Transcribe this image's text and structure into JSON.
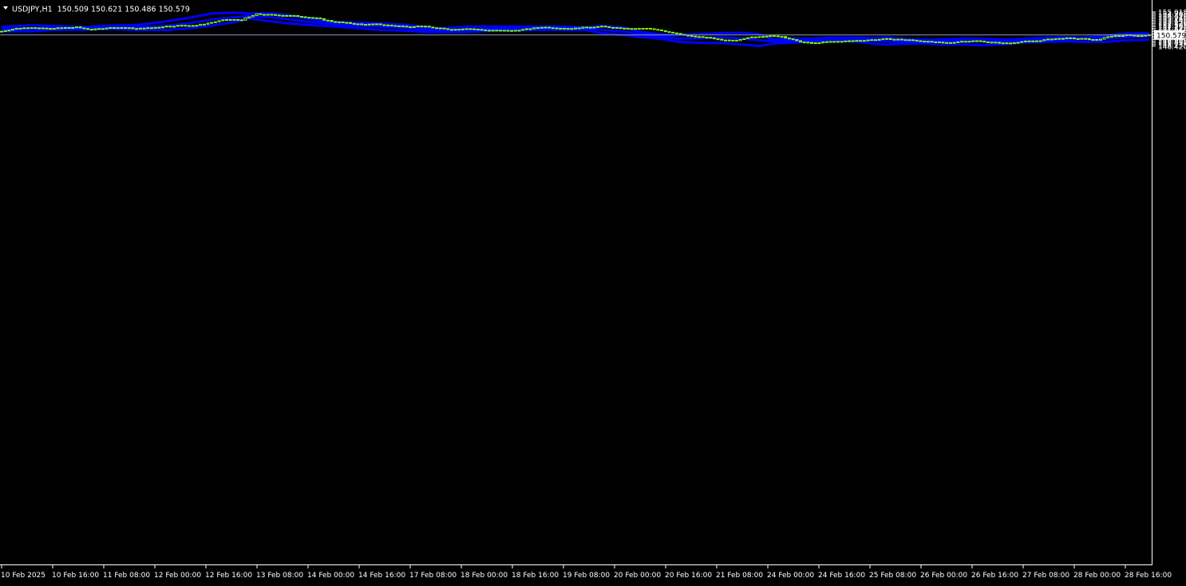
{
  "symbol": "USDJPY",
  "timeframe": "H1",
  "ohlc": {
    "open": "150.509",
    "high": "150.621",
    "low": "150.486",
    "close": "150.579"
  },
  "header_text": "USDJPY,H1  150.509 150.621 150.486 150.579",
  "current_price_label": "150.579",
  "colors": {
    "background": "#000000",
    "candle": "#7CFC00",
    "band": "#0000FF",
    "axis": "#FFFFFF",
    "price_line": "#8E9CC0"
  },
  "chart_data": {
    "type": "candlestick",
    "title": "",
    "ylim": [
      48.42,
      155.015
    ],
    "y_ticks": [
      155.015,
      154.705,
      154.39,
      154.075,
      153.76,
      153.445,
      153.13,
      152.82,
      152.505,
      152.19,
      151.875,
      151.56,
      151.25,
      150.935,
      150.62,
      150.305,
      149.99,
      149.68,
      149.365,
      149.05,
      148.735,
      148.42
    ],
    "y_tick_labels": [
      "155.015",
      "154.705",
      "154.390",
      "154.075",
      "153.760",
      "153.445",
      "153.130",
      "152.820",
      "152.505",
      "152.190",
      "151.875",
      "151.560",
      "151.250",
      "150.935",
      "150.620",
      "150.305",
      "149.990",
      "149.680",
      "149.365",
      "149.050",
      "148.735",
      "148.420"
    ],
    "x_labels": [
      "10 Feb 2025",
      "10 Feb 16:00",
      "11 Feb 08:00",
      "12 Feb 00:00",
      "12 Feb 16:00",
      "13 Feb 08:00",
      "14 Feb 00:00",
      "14 Feb 16:00",
      "17 Feb 08:00",
      "18 Feb 00:00",
      "18 Feb 16:00",
      "19 Feb 08:00",
      "20 Feb 00:00",
      "20 Feb 16:00",
      "21 Feb 08:00",
      "24 Feb 00:00",
      "24 Feb 16:00",
      "25 Feb 08:00",
      "26 Feb 00:00",
      "26 Feb 16:00",
      "27 Feb 08:00",
      "28 Feb 00:00",
      "28 Feb 16:00"
    ],
    "current_price": 150.579,
    "close_path": [
      [
        0,
        151.3
      ],
      [
        4,
        151.85
      ],
      [
        8,
        152.05
      ],
      [
        12,
        151.75
      ],
      [
        16,
        151.95
      ],
      [
        20,
        152.05
      ],
      [
        24,
        151.6
      ],
      [
        28,
        151.95
      ],
      [
        32,
        152.0
      ],
      [
        36,
        151.8
      ],
      [
        40,
        151.95
      ],
      [
        44,
        152.25
      ],
      [
        48,
        152.4
      ],
      [
        52,
        152.45
      ],
      [
        56,
        153.0
      ],
      [
        60,
        153.55
      ],
      [
        64,
        153.5
      ],
      [
        68,
        154.6
      ],
      [
        72,
        154.45
      ],
      [
        76,
        154.35
      ],
      [
        80,
        154.15
      ],
      [
        84,
        153.8
      ],
      [
        88,
        153.2
      ],
      [
        92,
        152.9
      ],
      [
        96,
        152.6
      ],
      [
        100,
        152.65
      ],
      [
        104,
        152.4
      ],
      [
        108,
        152.2
      ],
      [
        112,
        152.3
      ],
      [
        116,
        151.9
      ],
      [
        120,
        151.6
      ],
      [
        124,
        151.85
      ],
      [
        128,
        151.55
      ],
      [
        132,
        151.45
      ],
      [
        136,
        151.4
      ],
      [
        140,
        151.7
      ],
      [
        144,
        152.1
      ],
      [
        148,
        151.95
      ],
      [
        152,
        151.8
      ],
      [
        156,
        152.1
      ],
      [
        160,
        152.2
      ],
      [
        164,
        151.9
      ],
      [
        168,
        151.75
      ],
      [
        172,
        151.85
      ],
      [
        176,
        151.4
      ],
      [
        180,
        150.9
      ],
      [
        184,
        150.3
      ],
      [
        188,
        150.1
      ],
      [
        192,
        149.6
      ],
      [
        196,
        149.45
      ],
      [
        200,
        150.2
      ],
      [
        204,
        150.4
      ],
      [
        208,
        150.3
      ],
      [
        212,
        149.4
      ],
      [
        216,
        148.95
      ],
      [
        220,
        149.25
      ],
      [
        224,
        149.35
      ],
      [
        228,
        149.5
      ],
      [
        232,
        149.65
      ],
      [
        236,
        149.8
      ],
      [
        240,
        149.7
      ],
      [
        244,
        149.5
      ],
      [
        248,
        149.2
      ],
      [
        252,
        149.05
      ],
      [
        256,
        149.35
      ],
      [
        260,
        149.45
      ],
      [
        264,
        149.15
      ],
      [
        268,
        148.95
      ],
      [
        272,
        149.3
      ],
      [
        276,
        149.45
      ],
      [
        280,
        149.8
      ],
      [
        284,
        149.95
      ],
      [
        288,
        149.85
      ],
      [
        292,
        149.6
      ],
      [
        296,
        150.4
      ],
      [
        300,
        150.55
      ],
      [
        304,
        150.45
      ],
      [
        306,
        150.55
      ]
    ],
    "bands": [
      {
        "name": "",
        "values": [
          [
            0,
            152.15
          ],
          [
            8,
            152.45
          ],
          [
            14,
            152.3
          ],
          [
            22,
            152.1
          ],
          [
            28,
            152.35
          ],
          [
            36,
            152.5
          ],
          [
            44,
            153.2
          ],
          [
            50,
            153.9
          ],
          [
            56,
            154.7
          ],
          [
            62,
            154.9
          ],
          [
            66,
            154.7
          ],
          [
            72,
            154.75
          ],
          [
            76,
            154.45
          ],
          [
            82,
            153.7
          ],
          [
            88,
            153.1
          ],
          [
            94,
            152.95
          ],
          [
            100,
            152.85
          ],
          [
            108,
            152.5
          ],
          [
            114,
            151.95
          ],
          [
            118,
            151.85
          ],
          [
            124,
            152.2
          ],
          [
            132,
            152.2
          ],
          [
            140,
            152.2
          ],
          [
            148,
            152.2
          ],
          [
            156,
            152.05
          ],
          [
            160,
            152.3
          ],
          [
            166,
            152.0
          ],
          [
            170,
            151.2
          ],
          [
            176,
            150.65
          ],
          [
            180,
            150.55
          ],
          [
            186,
            150.75
          ],
          [
            192,
            150.95
          ],
          [
            198,
            151.0
          ],
          [
            202,
            150.7
          ],
          [
            206,
            149.7
          ],
          [
            210,
            149.85
          ],
          [
            216,
            149.9
          ],
          [
            222,
            150.05
          ],
          [
            228,
            150.05
          ],
          [
            232,
            150.0
          ],
          [
            236,
            150.1
          ],
          [
            240,
            149.85
          ],
          [
            246,
            149.65
          ],
          [
            250,
            149.7
          ],
          [
            256,
            149.85
          ],
          [
            262,
            149.85
          ],
          [
            268,
            149.65
          ],
          [
            272,
            149.8
          ],
          [
            278,
            150.05
          ],
          [
            284,
            150.1
          ],
          [
            288,
            150.0
          ],
          [
            294,
            150.45
          ],
          [
            300,
            150.85
          ],
          [
            306,
            150.9
          ]
        ]
      },
      {
        "name": "",
        "values": [
          [
            0,
            151.75
          ],
          [
            8,
            151.8
          ],
          [
            14,
            151.95
          ],
          [
            22,
            152.0
          ],
          [
            28,
            151.9
          ],
          [
            36,
            152.05
          ],
          [
            44,
            152.3
          ],
          [
            50,
            152.85
          ],
          [
            56,
            153.55
          ],
          [
            62,
            154.0
          ],
          [
            66,
            154.25
          ],
          [
            72,
            154.0
          ],
          [
            76,
            153.65
          ],
          [
            82,
            153.1
          ],
          [
            88,
            152.7
          ],
          [
            94,
            152.45
          ],
          [
            100,
            152.25
          ],
          [
            108,
            151.95
          ],
          [
            114,
            151.55
          ],
          [
            118,
            151.55
          ],
          [
            124,
            151.65
          ],
          [
            132,
            151.75
          ],
          [
            140,
            151.9
          ],
          [
            148,
            151.9
          ],
          [
            156,
            151.85
          ],
          [
            160,
            151.6
          ],
          [
            166,
            151.2
          ],
          [
            170,
            150.75
          ],
          [
            176,
            150.25
          ],
          [
            180,
            149.9
          ],
          [
            186,
            149.95
          ],
          [
            192,
            150.1
          ],
          [
            198,
            149.85
          ],
          [
            202,
            149.55
          ],
          [
            206,
            149.35
          ],
          [
            210,
            149.45
          ],
          [
            216,
            149.65
          ],
          [
            222,
            149.8
          ],
          [
            228,
            149.7
          ],
          [
            232,
            149.5
          ],
          [
            236,
            149.35
          ],
          [
            240,
            149.3
          ],
          [
            246,
            149.35
          ],
          [
            250,
            149.3
          ],
          [
            256,
            149.4
          ],
          [
            262,
            149.3
          ],
          [
            268,
            149.35
          ],
          [
            272,
            149.5
          ],
          [
            278,
            149.65
          ],
          [
            284,
            149.75
          ],
          [
            288,
            149.8
          ],
          [
            294,
            149.95
          ],
          [
            300,
            150.2
          ],
          [
            306,
            150.35
          ]
        ]
      },
      {
        "name": "",
        "values": [
          [
            0,
            151.3
          ],
          [
            8,
            151.3
          ],
          [
            14,
            151.55
          ],
          [
            22,
            151.6
          ],
          [
            28,
            151.75
          ],
          [
            36,
            151.55
          ],
          [
            44,
            151.55
          ],
          [
            50,
            151.85
          ],
          [
            56,
            152.4
          ],
          [
            62,
            153.05
          ],
          [
            66,
            153.75
          ],
          [
            72,
            153.2
          ],
          [
            76,
            152.85
          ],
          [
            82,
            152.5
          ],
          [
            88,
            152.25
          ],
          [
            94,
            151.95
          ],
          [
            100,
            151.6
          ],
          [
            108,
            151.4
          ],
          [
            114,
            151.1
          ],
          [
            118,
            151.15
          ],
          [
            124,
            151.15
          ],
          [
            132,
            151.45
          ],
          [
            140,
            151.55
          ],
          [
            148,
            151.55
          ],
          [
            156,
            151.5
          ],
          [
            160,
            150.95
          ],
          [
            166,
            150.55
          ],
          [
            170,
            150.2
          ],
          [
            176,
            149.85
          ],
          [
            180,
            149.3
          ],
          [
            186,
            149.05
          ],
          [
            192,
            149.05
          ],
          [
            198,
            148.7
          ],
          [
            202,
            148.45
          ],
          [
            206,
            148.95
          ],
          [
            210,
            149.05
          ],
          [
            216,
            149.35
          ],
          [
            222,
            149.5
          ],
          [
            228,
            149.3
          ],
          [
            232,
            148.9
          ],
          [
            236,
            148.75
          ],
          [
            240,
            148.85
          ],
          [
            246,
            148.95
          ],
          [
            250,
            148.75
          ],
          [
            256,
            148.75
          ],
          [
            262,
            148.6
          ],
          [
            268,
            148.85
          ],
          [
            272,
            149.15
          ],
          [
            278,
            149.25
          ],
          [
            284,
            149.35
          ],
          [
            288,
            149.25
          ],
          [
            294,
            149.25
          ],
          [
            300,
            149.55
          ],
          [
            306,
            149.65
          ]
        ]
      }
    ]
  }
}
